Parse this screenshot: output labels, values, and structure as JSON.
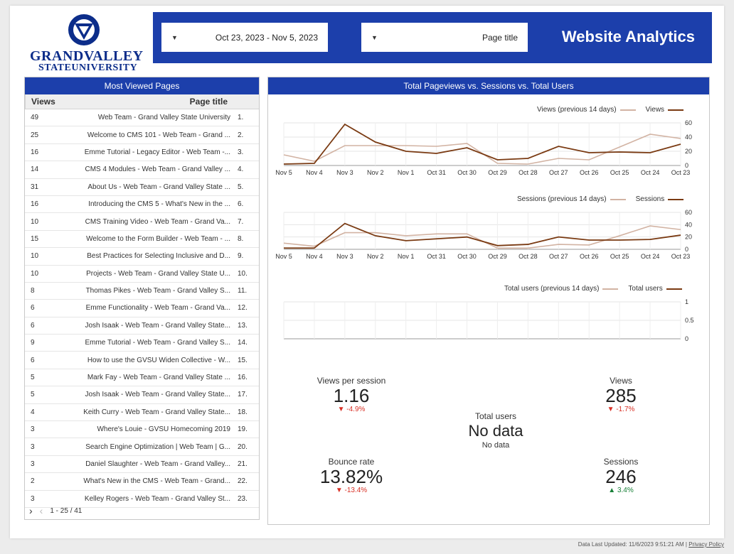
{
  "header": {
    "title": "Website Analytics",
    "page_filter": "Page title",
    "date_range": "Oct 23, 2023 - Nov 5, 2023",
    "logo_line1": "GRANDVALLEY",
    "logo_line2": "STATEUNIVERSITY"
  },
  "colors": {
    "brand": "#1c3fab",
    "current": "#7a3a12",
    "previous": "#d2b3a3"
  },
  "most_viewed": {
    "title": "Most Viewed Pages",
    "col_title": "Page title",
    "col_views": "Views",
    "rows": [
      {
        "rank": "1.",
        "title": "Web Team - Grand Valley State University",
        "views": "49"
      },
      {
        "rank": "2.",
        "title": "Welcome to CMS 101 - Web Team - Grand ...",
        "views": "25"
      },
      {
        "rank": "3.",
        "title": "Emme Tutorial - Legacy Editor - Web Team -...",
        "views": "16"
      },
      {
        "rank": "4.",
        "title": "CMS 4 Modules - Web Team - Grand Valley ...",
        "views": "14"
      },
      {
        "rank": "5.",
        "title": "About Us - Web Team - Grand Valley State ...",
        "views": "31"
      },
      {
        "rank": "6.",
        "title": "Introducing the CMS 5 - What's New in the ...",
        "views": "16"
      },
      {
        "rank": "7.",
        "title": "CMS Training Video - Web Team - Grand Va...",
        "views": "10"
      },
      {
        "rank": "8.",
        "title": "Welcome to the Form Builder - Web Team - ...",
        "views": "15"
      },
      {
        "rank": "9.",
        "title": "Best Practices for Selecting Inclusive and D...",
        "views": "10"
      },
      {
        "rank": "10.",
        "title": "Projects - Web Team - Grand Valley State U...",
        "views": "10"
      },
      {
        "rank": "11.",
        "title": "Thomas Pikes - Web Team - Grand Valley S...",
        "views": "8"
      },
      {
        "rank": "12.",
        "title": "Emme Functionality - Web Team - Grand Va...",
        "views": "6"
      },
      {
        "rank": "13.",
        "title": "Josh Isaak - Web Team - Grand Valley State...",
        "views": "6"
      },
      {
        "rank": "14.",
        "title": "Emme Tutorial - Web Team - Grand Valley S...",
        "views": "9"
      },
      {
        "rank": "15.",
        "title": "How to use the GVSU Widen Collective - W...",
        "views": "6"
      },
      {
        "rank": "16.",
        "title": "Mark Fay - Web Team - Grand Valley State ...",
        "views": "5"
      },
      {
        "rank": "17.",
        "title": "Josh Isaak - Web Team - Grand Valley State...",
        "views": "5"
      },
      {
        "rank": "18.",
        "title": "Keith Curry - Web Team - Grand Valley State...",
        "views": "4"
      },
      {
        "rank": "19.",
        "title": "Where's Louie - GVSU Homecoming 2019",
        "views": "3"
      },
      {
        "rank": "20.",
        "title": "Search Engine Optimization | Web Team | G...",
        "views": "3"
      },
      {
        "rank": "21.",
        "title": "Daniel Slaughter - Web Team - Grand Valley...",
        "views": "3"
      },
      {
        "rank": "22.",
        "title": "What's New in the CMS - Web Team - Grand...",
        "views": "2"
      },
      {
        "rank": "23.",
        "title": "Kelley Rogers - Web Team - Grand Valley St...",
        "views": "3"
      }
    ],
    "pagination": "1 - 25 / 41"
  },
  "right_panel": {
    "title": "Total Pageviews vs. Sessions vs. Total Users"
  },
  "chart_data": [
    {
      "type": "line",
      "x": [
        "Oct 23",
        "Oct 24",
        "Oct 25",
        "Oct 26",
        "Oct 27",
        "Oct 28",
        "Oct 29",
        "Oct 30",
        "Oct 31",
        "Nov 1",
        "Nov 2",
        "Nov 3",
        "Nov 4",
        "Nov 5"
      ],
      "ylim": [
        0,
        60
      ],
      "yticks": [
        "0",
        "20",
        "40",
        "60"
      ],
      "series": [
        {
          "name": "Views",
          "values": [
            30,
            18,
            19,
            18,
            27,
            10,
            8,
            25,
            17,
            20,
            33,
            58,
            3,
            2
          ]
        },
        {
          "name": "Views (previous 14 days)",
          "values": [
            38,
            44,
            26,
            8,
            10,
            2,
            3,
            31,
            27,
            28,
            28,
            28,
            6,
            15
          ]
        }
      ]
    },
    {
      "type": "line",
      "x": [
        "Oct 23",
        "Oct 24",
        "Oct 25",
        "Oct 26",
        "Oct 27",
        "Oct 28",
        "Oct 29",
        "Oct 30",
        "Oct 31",
        "Nov 1",
        "Nov 2",
        "Nov 3",
        "Nov 4",
        "Nov 5"
      ],
      "ylim": [
        0,
        60
      ],
      "yticks": [
        "0",
        "20",
        "40",
        "60"
      ],
      "series": [
        {
          "name": "Sessions",
          "values": [
            23,
            16,
            15,
            15,
            20,
            8,
            6,
            20,
            17,
            14,
            22,
            42,
            2,
            2
          ]
        },
        {
          "name": "Sessions (previous 14 days)",
          "values": [
            32,
            38,
            22,
            7,
            8,
            2,
            2,
            25,
            25,
            22,
            27,
            27,
            5,
            10
          ]
        }
      ]
    },
    {
      "type": "line",
      "x": [],
      "ylim": [
        0,
        1
      ],
      "yticks": [
        "0",
        "0.5",
        "1"
      ],
      "series": [
        {
          "name": "Total users",
          "values": []
        },
        {
          "name": "Total users (previous 14 days)",
          "values": []
        }
      ]
    }
  ],
  "metrics": {
    "views": {
      "label": "Views",
      "value": "285",
      "delta": "-1.7%",
      "arrow": "▼"
    },
    "views_per_session": {
      "label": "Views per session",
      "value": "1.16",
      "delta": "-4.9%",
      "arrow": "▼"
    },
    "total_users": {
      "label": "Total users",
      "value": "No data",
      "sub": "No data"
    },
    "sessions": {
      "label": "Sessions",
      "value": "246",
      "delta": "3.4%",
      "arrow": "▲"
    },
    "bounce_rate": {
      "label": "Bounce rate",
      "value": "13.82%",
      "delta": "-13.4%",
      "arrow": "▼"
    }
  },
  "footer": {
    "updated": "Data Last Updated: 11/6/2023 9:51:21 AM",
    "sep": "|",
    "privacy": "Privacy Policy"
  }
}
